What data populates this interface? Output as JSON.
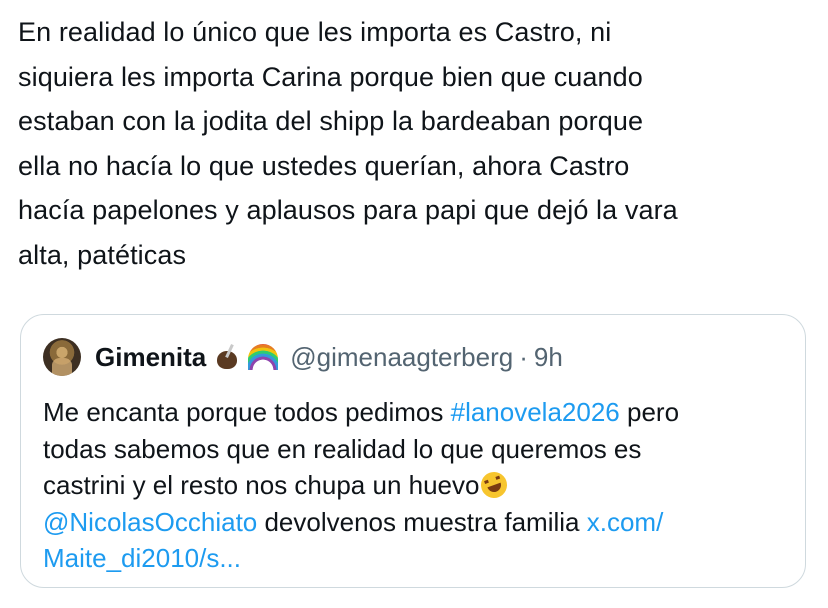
{
  "tweet": {
    "lines": [
      "En realidad lo único que les importa es Castro, ni",
      "siquiera les importa Carina porque bien que cuando",
      "estaban con la jodita del shipp la bardeaban porque",
      "ella no hacía lo que ustedes querían, ahora Castro",
      "hacía papelones y aplausos para papi que dejó la vara",
      "alta, patéticas"
    ]
  },
  "quote": {
    "author_name": "Gimenita",
    "name_emojis": [
      "mate-icon",
      "rainbow-icon"
    ],
    "handle": "@gimenaagterberg",
    "separator": "·",
    "time": "9h",
    "line1_a": "Me encanta porque todos pedimos ",
    "hashtag": "#lanovela2026",
    "line1_b": " pero",
    "line2": "todas sabemos que en realidad lo que queremos es",
    "line3": "castrini y el resto nos chupa un huevo",
    "line3_emoji": "rolling-on-floor-laughing-icon",
    "mention": "@NicolasOcchiato",
    "line4_b": " devolvenos muestra familia ",
    "url_part1": "x.com/",
    "url_part2": "Maite_di2010/s..."
  },
  "colors": {
    "text": "#0f1419",
    "secondary": "#536471",
    "link": "#1d9bf0",
    "border": "#cfd9de"
  }
}
